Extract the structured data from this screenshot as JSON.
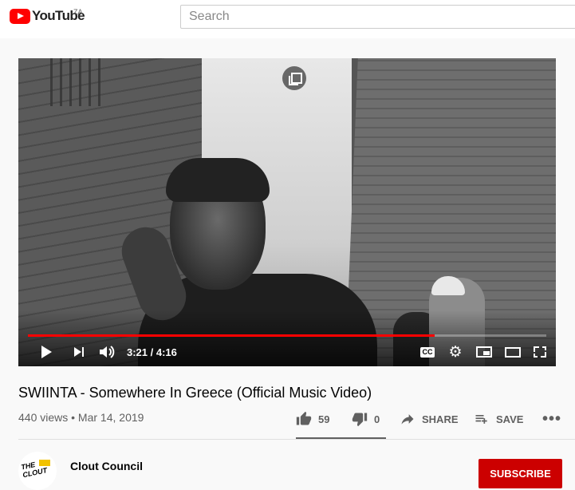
{
  "masthead": {
    "logo_text": "YouTube",
    "country_code": "ZA",
    "search_placeholder": "Search"
  },
  "player": {
    "current_time": "3:21",
    "duration": "4:16",
    "time_display": "3:21 / 4:16",
    "progress_fraction": 0.785,
    "cc_label": "CC"
  },
  "video": {
    "title": "SWIINTA - Somewhere In Greece (Official Music Video)",
    "views": "440 views",
    "separator": "•",
    "date": "Mar 14, 2019",
    "meta_line": "440 views • Mar 14, 2019"
  },
  "actions": {
    "likes": "59",
    "dislikes": "0",
    "share_label": "SHARE",
    "save_label": "SAVE",
    "more_label": "•••"
  },
  "channel": {
    "name": "Clout Council",
    "avatar_text": "THE CLOUT",
    "subscribe_label": "SUBSCRIBE"
  },
  "colors": {
    "brand_red": "#ff0000",
    "subscribe_red": "#cc0000",
    "text_primary": "#030303",
    "text_secondary": "#606060"
  },
  "icons": [
    "youtube-logo-icon",
    "miniplayer-overlay-icon",
    "play-icon",
    "next-icon",
    "volume-icon",
    "cc-icon",
    "settings-gear-icon",
    "miniplayer-icon",
    "theater-mode-icon",
    "fullscreen-icon",
    "thumbs-up-icon",
    "thumbs-down-icon",
    "share-arrow-icon",
    "add-to-playlist-icon",
    "more-dots-icon"
  ]
}
